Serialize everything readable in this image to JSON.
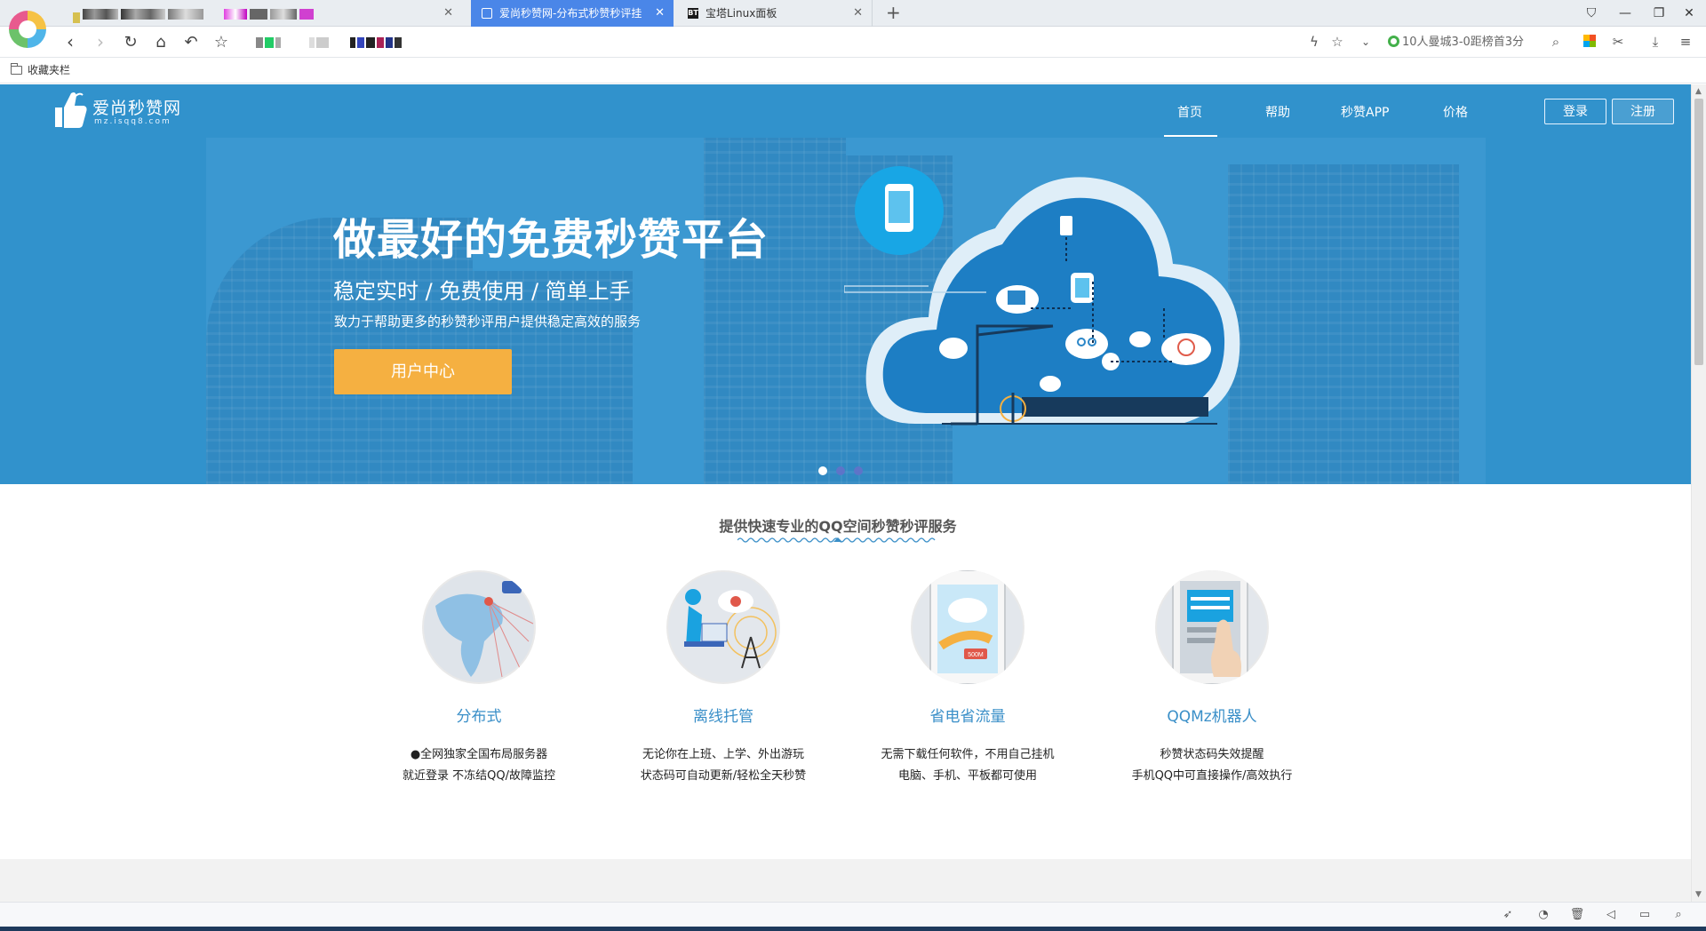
{
  "browser": {
    "tabs": [
      {
        "title": "",
        "active": false
      },
      {
        "title": "爱尚秒赞网-分布式秒赞秒评挂",
        "active": true
      },
      {
        "title": "宝塔Linux面板",
        "active": false,
        "favicon": "BT"
      }
    ],
    "new_tab_icon": "+",
    "news_ticker": "10人曼城3-0距榜首3分",
    "bookmarks_label": "收藏夹栏",
    "colors": {
      "active_tab": "#4a86e8",
      "chrome_bg": "#e9edf1"
    }
  },
  "site": {
    "logo_text": "爱尚秒赞网",
    "logo_sub": "mz.isqq8.com",
    "nav": [
      {
        "label": "首页",
        "active": true
      },
      {
        "label": "帮助",
        "active": false
      },
      {
        "label": "秒赞APP",
        "active": false
      },
      {
        "label": "价格",
        "active": false
      }
    ],
    "login_label": "登录",
    "register_label": "注册",
    "hero": {
      "title": "做最好的免费秒赞平台",
      "subtitle": "稳定实时 / 免费使用 / 简单上手",
      "description": "致力于帮助更多的秒赞秒评用户提供稳定高效的服务",
      "cta": "用户中心",
      "slide_count": 3,
      "active_slide": 0
    },
    "features_title": "提供快速专业的QQ空间秒赞秒评服务",
    "features": [
      {
        "title": "分布式",
        "line1": "全网独家全国布局服务器",
        "line2": "就近登录 不冻结QQ/故障监控",
        "icon": "globe-map-icon"
      },
      {
        "title": "离线托管",
        "line1": "无论你在上班、上学、外出游玩",
        "line2": "状态码可自动更新/轻松全天秒赞",
        "icon": "offline-hosting-icon"
      },
      {
        "title": "省电省流量",
        "line1": "无需下载任何软件，不用自己挂机",
        "line2": "电脑、手机、平板都可使用",
        "icon": "phone-cloud-icon",
        "badge": "500M"
      },
      {
        "title": "QQMz机器人",
        "line1": "秒赞状态码失效提醒",
        "line2": "手机QQ中可直接操作/高效执行",
        "icon": "robot-phone-icon"
      }
    ],
    "colors": {
      "hero_bg": "#3192cc",
      "cta": "#f5b041",
      "feature_title": "#3a8fc8"
    }
  }
}
